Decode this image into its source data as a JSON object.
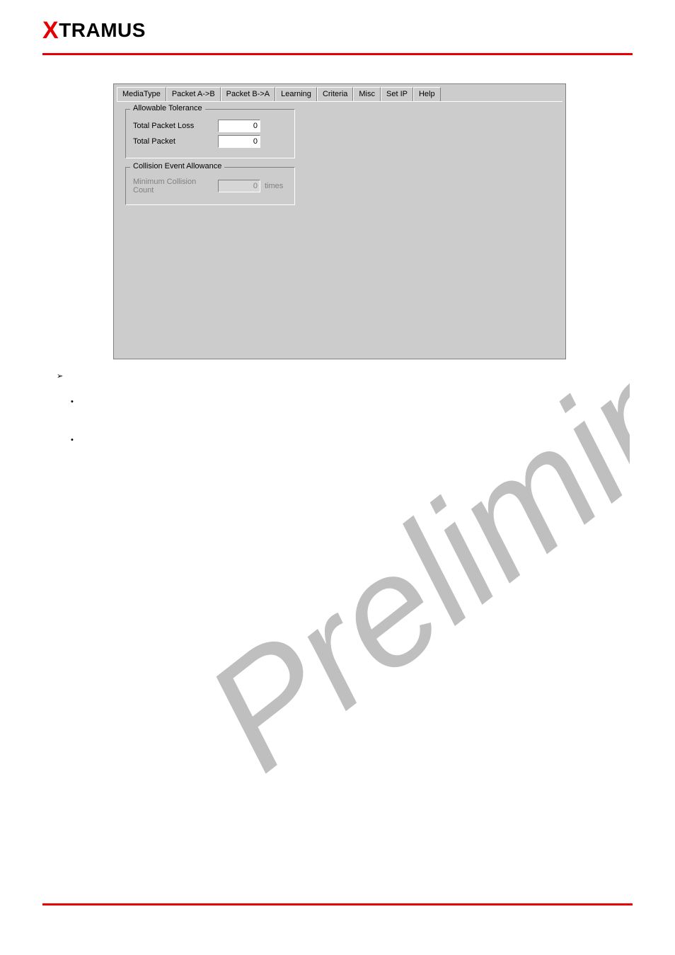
{
  "logo": {
    "prefix": "X",
    "rest": "TRAMUS"
  },
  "tabs": {
    "mediatype": "MediaType",
    "packet_ab": "Packet A->B",
    "packet_ba": "Packet B->A",
    "learning": "Learning",
    "criteria": "Criteria",
    "misc": "Misc",
    "set_ip": "Set IP",
    "help": "Help"
  },
  "groups": {
    "allowable": {
      "title": "Allowable Tolerance",
      "total_packet_loss_label": "Total Packet Loss",
      "total_packet_loss_value": "0",
      "total_packet_label": "Total Packet",
      "total_packet_value": "0"
    },
    "collision": {
      "title": "Collision Event Allowance",
      "min_collision_label": "Minimum Collision Count",
      "min_collision_value": "0",
      "suffix": "times"
    }
  },
  "bullets": {
    "arrow": "➢",
    "dot": "•"
  }
}
